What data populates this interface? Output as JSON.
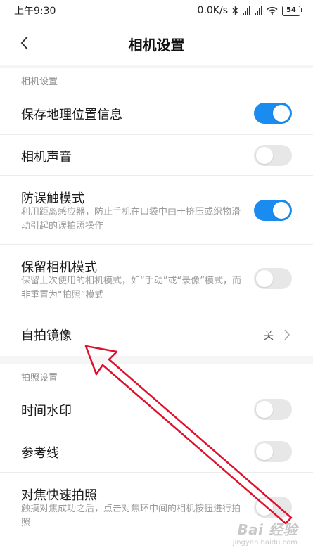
{
  "status_bar": {
    "time": "上午9:30",
    "network_speed": "0.0K/s",
    "battery": "54",
    "icons": [
      "bluetooth-icon",
      "signal-icon",
      "signal-icon",
      "wifi-icon",
      "battery-icon"
    ]
  },
  "header": {
    "title": "相机设置",
    "back_icon": "chevron-left-icon"
  },
  "sections": [
    {
      "header": "相机设置",
      "items": [
        {
          "title": "保存地理位置信息",
          "toggle": "on"
        },
        {
          "title": "相机声音",
          "toggle": "off"
        },
        {
          "title": "防误触模式",
          "description": "利用距离感应器，防止手机在口袋中由于挤压或织物滑动引起的误拍照操作",
          "toggle": "on"
        },
        {
          "title": "保留相机模式",
          "description": "保留上次使用的相机模式，如“手动”或“录像”模式，而非重置为“拍照”模式",
          "toggle": "off"
        },
        {
          "title": "自拍镜像",
          "value": "关",
          "chevron_icon": "chevron-right-icon"
        }
      ]
    },
    {
      "header": "拍照设置",
      "items": [
        {
          "title": "时间水印",
          "toggle": "off"
        },
        {
          "title": "参考线",
          "toggle": "off"
        },
        {
          "title": "对焦快速拍照",
          "description": "触摸对焦成功之后，点击对焦环中间的相机按钮进行拍照",
          "toggle": "off"
        }
      ]
    }
  ],
  "colors": {
    "toggle_on": "#1a8cf0",
    "toggle_off": "#e7e7e7",
    "annotation_arrow": "#e0102c"
  },
  "watermark": {
    "logo": "Bai 经验",
    "url": "jingyan.baidu.com"
  }
}
